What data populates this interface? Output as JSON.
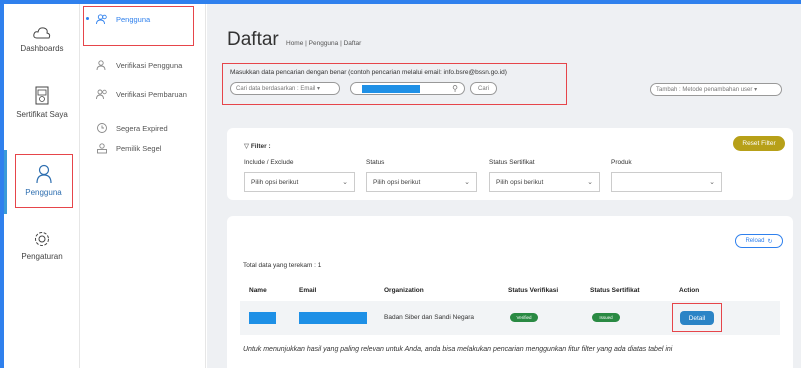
{
  "rail": {
    "items": [
      {
        "label": "Dashboards",
        "icon": "cloud-icon"
      },
      {
        "label": "Sertifikat Saya",
        "icon": "certificate-icon"
      },
      {
        "label": "Pengguna",
        "icon": "user-icon",
        "active": true
      },
      {
        "label": "Pengaturan",
        "icon": "gear-icon"
      }
    ]
  },
  "submenu": {
    "items": [
      {
        "label": "Pengguna",
        "icon": "users-icon",
        "active": true
      },
      {
        "label": "Verifikasi Pengguna",
        "icon": "user-check-icon"
      },
      {
        "label": "Verifikasi Pembaruan",
        "icon": "users-refresh-icon"
      },
      {
        "label": "Segera Expired",
        "icon": "clock-icon"
      },
      {
        "label": "Pemilik Segel",
        "icon": "user-seal-icon"
      }
    ]
  },
  "header": {
    "title": "Daftar",
    "breadcrumb": "Home | Pengguna | Daftar"
  },
  "search": {
    "hint": "Masukkan data pencarian dengan benar (contoh pencarian melalui email: info.bsre@bssn.go.id)",
    "by_label": "Cari data berdasarkan : Email ▾",
    "button_label": "Cari",
    "add_label": "Tambah : Metode penambahan user ▾"
  },
  "filter": {
    "title": "Filter :",
    "reset_label": "Reset Filter",
    "fields": [
      {
        "label": "Include / Exclude",
        "value": "Pilih opsi berikut"
      },
      {
        "label": "Status",
        "value": "Pilih opsi berikut"
      },
      {
        "label": "Status Sertifikat",
        "value": "Pilih opsi berikut"
      },
      {
        "label": "Produk",
        "value": ""
      }
    ]
  },
  "results": {
    "reload_label": "Reload",
    "total_label": "Total data yang terekam : 1",
    "columns": [
      "Name",
      "Email",
      "Organization",
      "Status Verifikasi",
      "Status Sertifikat",
      "Action"
    ],
    "rows": [
      {
        "organization": "Badan Siber dan Sandi Negara",
        "status_verifikasi": "Verified",
        "status_sertifikat": "Issued",
        "action": "Detail"
      }
    ],
    "footnote": "Untuk menunjukkan hasil yang paling relevan untuk Anda, anda bisa melakukan pencarian menggunkan fitur filter yang ada diatas tabel ini"
  },
  "colors": {
    "accent": "#2f80ed",
    "highlight": "#e6454a",
    "verified": "#2a8a43",
    "reset": "#b7a018"
  }
}
